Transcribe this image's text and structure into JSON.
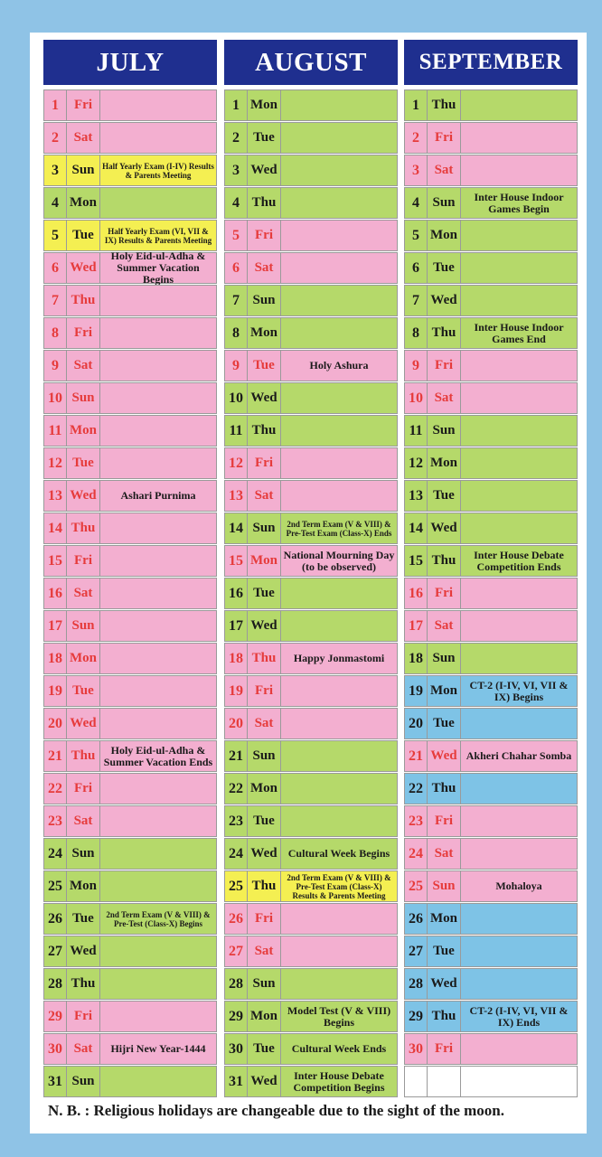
{
  "months": [
    {
      "name": "JULY",
      "rows": [
        {
          "d": "1",
          "w": "Fri",
          "e": "",
          "c": "pink",
          "h": true
        },
        {
          "d": "2",
          "w": "Sat",
          "e": "",
          "c": "pink",
          "h": true
        },
        {
          "d": "3",
          "w": "Sun",
          "e": "Half Yearly Exam (I-IV) Results & Parents Meeting",
          "c": "yellow",
          "h": false,
          "s": true
        },
        {
          "d": "4",
          "w": "Mon",
          "e": "",
          "c": "green",
          "h": false
        },
        {
          "d": "5",
          "w": "Tue",
          "e": "Half Yearly Exam (VI, VII & IX) Results & Parents Meeting",
          "c": "yellow",
          "h": false,
          "s": true
        },
        {
          "d": "6",
          "w": "Wed",
          "e": "Holy Eid-ul-Adha & Summer Vacation Begins",
          "c": "pink",
          "h": true
        },
        {
          "d": "7",
          "w": "Thu",
          "e": "",
          "c": "pink",
          "h": true
        },
        {
          "d": "8",
          "w": "Fri",
          "e": "",
          "c": "pink",
          "h": true
        },
        {
          "d": "9",
          "w": "Sat",
          "e": "",
          "c": "pink",
          "h": true
        },
        {
          "d": "10",
          "w": "Sun",
          "e": "",
          "c": "pink",
          "h": true
        },
        {
          "d": "11",
          "w": "Mon",
          "e": "",
          "c": "pink",
          "h": true
        },
        {
          "d": "12",
          "w": "Tue",
          "e": "",
          "c": "pink",
          "h": true
        },
        {
          "d": "13",
          "w": "Wed",
          "e": "Ashari Purnima",
          "c": "pink",
          "h": true
        },
        {
          "d": "14",
          "w": "Thu",
          "e": "",
          "c": "pink",
          "h": true
        },
        {
          "d": "15",
          "w": "Fri",
          "e": "",
          "c": "pink",
          "h": true
        },
        {
          "d": "16",
          "w": "Sat",
          "e": "",
          "c": "pink",
          "h": true
        },
        {
          "d": "17",
          "w": "Sun",
          "e": "",
          "c": "pink",
          "h": true
        },
        {
          "d": "18",
          "w": "Mon",
          "e": "",
          "c": "pink",
          "h": true
        },
        {
          "d": "19",
          "w": "Tue",
          "e": "",
          "c": "pink",
          "h": true
        },
        {
          "d": "20",
          "w": "Wed",
          "e": "",
          "c": "pink",
          "h": true
        },
        {
          "d": "21",
          "w": "Thu",
          "e": "Holy Eid-ul-Adha & Summer Vacation Ends",
          "c": "pink",
          "h": true
        },
        {
          "d": "22",
          "w": "Fri",
          "e": "",
          "c": "pink",
          "h": true
        },
        {
          "d": "23",
          "w": "Sat",
          "e": "",
          "c": "pink",
          "h": true
        },
        {
          "d": "24",
          "w": "Sun",
          "e": "",
          "c": "green",
          "h": false
        },
        {
          "d": "25",
          "w": "Mon",
          "e": "",
          "c": "green",
          "h": false
        },
        {
          "d": "26",
          "w": "Tue",
          "e": "2nd Term Exam (V & VIII) & Pre-Test (Class-X) Begins",
          "c": "green",
          "h": false,
          "s": true
        },
        {
          "d": "27",
          "w": "Wed",
          "e": "",
          "c": "green",
          "h": false
        },
        {
          "d": "28",
          "w": "Thu",
          "e": "",
          "c": "green",
          "h": false
        },
        {
          "d": "29",
          "w": "Fri",
          "e": "",
          "c": "pink",
          "h": true
        },
        {
          "d": "30",
          "w": "Sat",
          "e": "Hijri New Year-1444",
          "c": "pink",
          "h": true
        },
        {
          "d": "31",
          "w": "Sun",
          "e": "",
          "c": "green",
          "h": false
        }
      ]
    },
    {
      "name": "AUGUST",
      "rows": [
        {
          "d": "1",
          "w": "Mon",
          "e": "",
          "c": "green",
          "h": false
        },
        {
          "d": "2",
          "w": "Tue",
          "e": "",
          "c": "green",
          "h": false
        },
        {
          "d": "3",
          "w": "Wed",
          "e": "",
          "c": "green",
          "h": false
        },
        {
          "d": "4",
          "w": "Thu",
          "e": "",
          "c": "green",
          "h": false
        },
        {
          "d": "5",
          "w": "Fri",
          "e": "",
          "c": "pink",
          "h": true
        },
        {
          "d": "6",
          "w": "Sat",
          "e": "",
          "c": "pink",
          "h": true
        },
        {
          "d": "7",
          "w": "Sun",
          "e": "",
          "c": "green",
          "h": false
        },
        {
          "d": "8",
          "w": "Mon",
          "e": "",
          "c": "green",
          "h": false
        },
        {
          "d": "9",
          "w": "Tue",
          "e": "Holy Ashura",
          "c": "pink",
          "h": true
        },
        {
          "d": "10",
          "w": "Wed",
          "e": "",
          "c": "green",
          "h": false
        },
        {
          "d": "11",
          "w": "Thu",
          "e": "",
          "c": "green",
          "h": false
        },
        {
          "d": "12",
          "w": "Fri",
          "e": "",
          "c": "pink",
          "h": true
        },
        {
          "d": "13",
          "w": "Sat",
          "e": "",
          "c": "pink",
          "h": true
        },
        {
          "d": "14",
          "w": "Sun",
          "e": "2nd Term Exam (V & VIII) & Pre-Test Exam (Class-X) Ends",
          "c": "green",
          "h": false,
          "s": true
        },
        {
          "d": "15",
          "w": "Mon",
          "e": "National Mourning Day (to be observed)",
          "c": "pink",
          "h": true
        },
        {
          "d": "16",
          "w": "Tue",
          "e": "",
          "c": "green",
          "h": false
        },
        {
          "d": "17",
          "w": "Wed",
          "e": "",
          "c": "green",
          "h": false
        },
        {
          "d": "18",
          "w": "Thu",
          "e": "Happy Jonmastomi",
          "c": "pink",
          "h": true
        },
        {
          "d": "19",
          "w": "Fri",
          "e": "",
          "c": "pink",
          "h": true
        },
        {
          "d": "20",
          "w": "Sat",
          "e": "",
          "c": "pink",
          "h": true
        },
        {
          "d": "21",
          "w": "Sun",
          "e": "",
          "c": "green",
          "h": false
        },
        {
          "d": "22",
          "w": "Mon",
          "e": "",
          "c": "green",
          "h": false
        },
        {
          "d": "23",
          "w": "Tue",
          "e": "",
          "c": "green",
          "h": false
        },
        {
          "d": "24",
          "w": "Wed",
          "e": "Cultural Week Begins",
          "c": "green",
          "h": false
        },
        {
          "d": "25",
          "w": "Thu",
          "e": "2nd Term Exam (V & VIII) & Pre-Test Exam (Class-X) Results & Parents Meeting",
          "c": "yellow",
          "h": false,
          "s": true
        },
        {
          "d": "26",
          "w": "Fri",
          "e": "",
          "c": "pink",
          "h": true
        },
        {
          "d": "27",
          "w": "Sat",
          "e": "",
          "c": "pink",
          "h": true
        },
        {
          "d": "28",
          "w": "Sun",
          "e": "",
          "c": "green",
          "h": false
        },
        {
          "d": "29",
          "w": "Mon",
          "e": "Model Test (V & VIII) Begins",
          "c": "green",
          "h": false
        },
        {
          "d": "30",
          "w": "Tue",
          "e": "Cultural Week Ends",
          "c": "green",
          "h": false
        },
        {
          "d": "31",
          "w": "Wed",
          "e": "Inter House Debate Competition Begins",
          "c": "green",
          "h": false
        }
      ]
    },
    {
      "name": "SEPTEMBER",
      "rows": [
        {
          "d": "1",
          "w": "Thu",
          "e": "",
          "c": "green",
          "h": false
        },
        {
          "d": "2",
          "w": "Fri",
          "e": "",
          "c": "pink",
          "h": true
        },
        {
          "d": "3",
          "w": "Sat",
          "e": "",
          "c": "pink",
          "h": true
        },
        {
          "d": "4",
          "w": "Sun",
          "e": "Inter House Indoor Games Begin",
          "c": "green",
          "h": false
        },
        {
          "d": "5",
          "w": "Mon",
          "e": "",
          "c": "green",
          "h": false
        },
        {
          "d": "6",
          "w": "Tue",
          "e": "",
          "c": "green",
          "h": false
        },
        {
          "d": "7",
          "w": "Wed",
          "e": "",
          "c": "green",
          "h": false
        },
        {
          "d": "8",
          "w": "Thu",
          "e": "Inter House Indoor Games End",
          "c": "green",
          "h": false
        },
        {
          "d": "9",
          "w": "Fri",
          "e": "",
          "c": "pink",
          "h": true
        },
        {
          "d": "10",
          "w": "Sat",
          "e": "",
          "c": "pink",
          "h": true
        },
        {
          "d": "11",
          "w": "Sun",
          "e": "",
          "c": "green",
          "h": false
        },
        {
          "d": "12",
          "w": "Mon",
          "e": "",
          "c": "green",
          "h": false
        },
        {
          "d": "13",
          "w": "Tue",
          "e": "",
          "c": "green",
          "h": false
        },
        {
          "d": "14",
          "w": "Wed",
          "e": "",
          "c": "green",
          "h": false
        },
        {
          "d": "15",
          "w": "Thu",
          "e": "Inter House Debate Competition Ends",
          "c": "green",
          "h": false
        },
        {
          "d": "16",
          "w": "Fri",
          "e": "",
          "c": "pink",
          "h": true
        },
        {
          "d": "17",
          "w": "Sat",
          "e": "",
          "c": "pink",
          "h": true
        },
        {
          "d": "18",
          "w": "Sun",
          "e": "",
          "c": "green",
          "h": false
        },
        {
          "d": "19",
          "w": "Mon",
          "e": "CT-2 (I-IV, VI, VII & IX) Begins",
          "c": "blue",
          "h": false
        },
        {
          "d": "20",
          "w": "Tue",
          "e": "",
          "c": "blue",
          "h": false
        },
        {
          "d": "21",
          "w": "Wed",
          "e": "Akheri Chahar Somba",
          "c": "pink",
          "h": true
        },
        {
          "d": "22",
          "w": "Thu",
          "e": "",
          "c": "blue",
          "h": false
        },
        {
          "d": "23",
          "w": "Fri",
          "e": "",
          "c": "pink",
          "h": true
        },
        {
          "d": "24",
          "w": "Sat",
          "e": "",
          "c": "pink",
          "h": true
        },
        {
          "d": "25",
          "w": "Sun",
          "e": "Mohaloya",
          "c": "pink",
          "h": true
        },
        {
          "d": "26",
          "w": "Mon",
          "e": "",
          "c": "blue",
          "h": false
        },
        {
          "d": "27",
          "w": "Tue",
          "e": "",
          "c": "blue",
          "h": false
        },
        {
          "d": "28",
          "w": "Wed",
          "e": "",
          "c": "blue",
          "h": false
        },
        {
          "d": "29",
          "w": "Thu",
          "e": "CT-2 (I-IV, VI, VII & IX) Ends",
          "c": "blue",
          "h": false
        },
        {
          "d": "30",
          "w": "Fri",
          "e": "",
          "c": "pink",
          "h": true
        },
        {
          "d": "",
          "w": "",
          "e": "",
          "c": "white",
          "h": false
        }
      ]
    }
  ],
  "footnote": "N. B. : Religious holidays are changeable due to the sight of the moon."
}
